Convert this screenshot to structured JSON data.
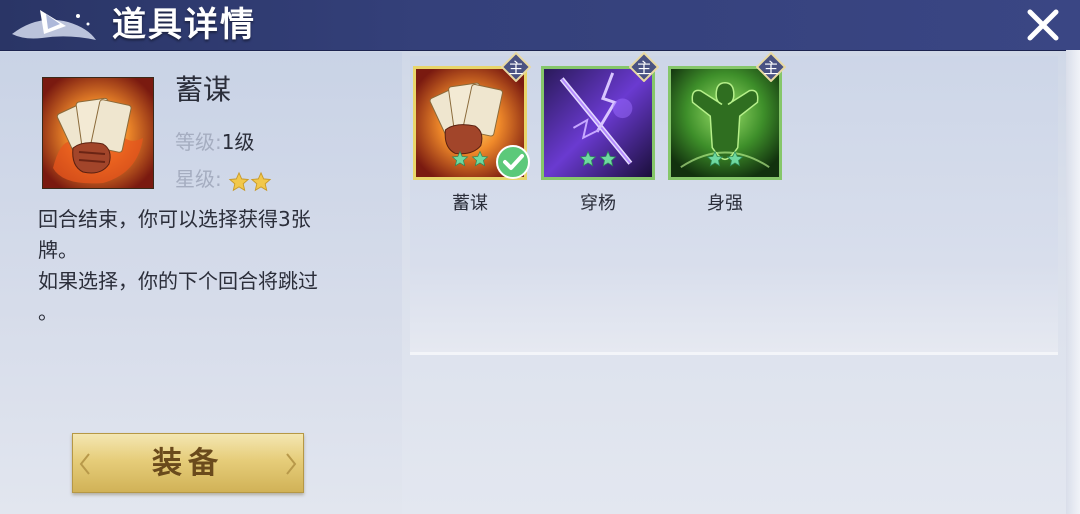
{
  "header": {
    "title": "道具详情"
  },
  "item": {
    "name": "蓄谋",
    "level_label": "等级:",
    "level_value": "1级",
    "star_label": "星级:",
    "star_count": 2,
    "description_lines": [
      "回合结束，你可以选择获得3张",
      "牌。",
      "如果选择，你的下个回合将跳过",
      "。"
    ]
  },
  "equip_button": {
    "label": "装备"
  },
  "skills": [
    {
      "name": "蓄谋",
      "badge": "主",
      "stars": 2,
      "selected": true
    },
    {
      "name": "穿杨",
      "badge": "主",
      "stars": 2,
      "selected": false
    },
    {
      "name": "身强",
      "badge": "主",
      "stars": 2,
      "selected": false
    }
  ],
  "colors": {
    "title_bar": "#34407a",
    "star": "#f2c84b",
    "slot_star": "#6fd9a0",
    "slot_border": "#86c76a",
    "selected_border": "#e8d56a",
    "button_gold": "#e6cd7a"
  },
  "icons": {
    "close": "close-icon",
    "check": "check-icon",
    "star": "star-icon"
  }
}
